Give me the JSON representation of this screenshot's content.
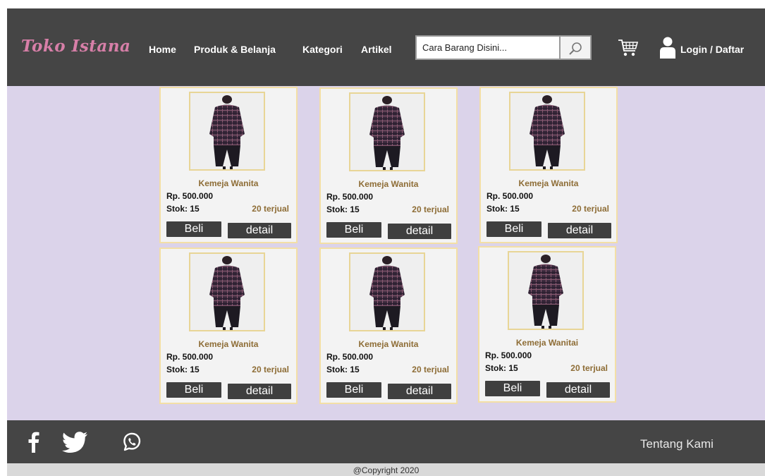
{
  "header": {
    "logo": "Toko Istana",
    "nav": {
      "home": "Home",
      "produk": "Produk & Belanja",
      "kategori": "Kategori",
      "artikel": "Artikel"
    },
    "search": {
      "value": "Cara Barang Disini...",
      "icon": "search-icon"
    },
    "cart_icon": "cart-icon",
    "user_icon": "user-icon",
    "login": "Login / Daftar"
  },
  "products": [
    {
      "name": "Kemeja Wanita",
      "price": "Rp. 500.000",
      "stock": "Stok: 15",
      "sold": "20 terjual",
      "buy": "Beli",
      "detail": "detail"
    },
    {
      "name": "Kemeja Wanita",
      "price": "Rp. 500.000",
      "stock": "Stok: 15",
      "sold": "20 terjual",
      "buy": "Beli",
      "detail": "detail"
    },
    {
      "name": "Kemeja Wanita",
      "price": "Rp. 500.000",
      "stock": "Stok: 15",
      "sold": "20 terjual",
      "buy": "Beli",
      "detail": "detail"
    },
    {
      "name": "Kemeja Wanita",
      "price": "Rp. 500.000",
      "stock": "Stok: 15",
      "sold": "20 terjual",
      "buy": "Beli",
      "detail": "detail"
    },
    {
      "name": "Kemeja Wanita",
      "price": "Rp. 500.000",
      "stock": "Stok: 15",
      "sold": "20 terjual",
      "buy": "Beli",
      "detail": "detail"
    },
    {
      "name": "Kemeja Wanitai",
      "price": "Rp. 500.000",
      "stock": "Stok: 15",
      "sold": "20 terjual",
      "buy": "Beli",
      "detail": "detail"
    }
  ],
  "footer": {
    "social_icons": [
      "facebook-icon",
      "twitter-icon",
      "whatsapp-icon"
    ],
    "about": "Tentang Kami",
    "copyright": "@Copyright 2020"
  },
  "colors": {
    "header_bg": "#454545",
    "content_bg": "#dbd3ea",
    "logo": "#d77fa8",
    "accent_text": "#8e6d36",
    "card_border": "#f3dfa6"
  }
}
